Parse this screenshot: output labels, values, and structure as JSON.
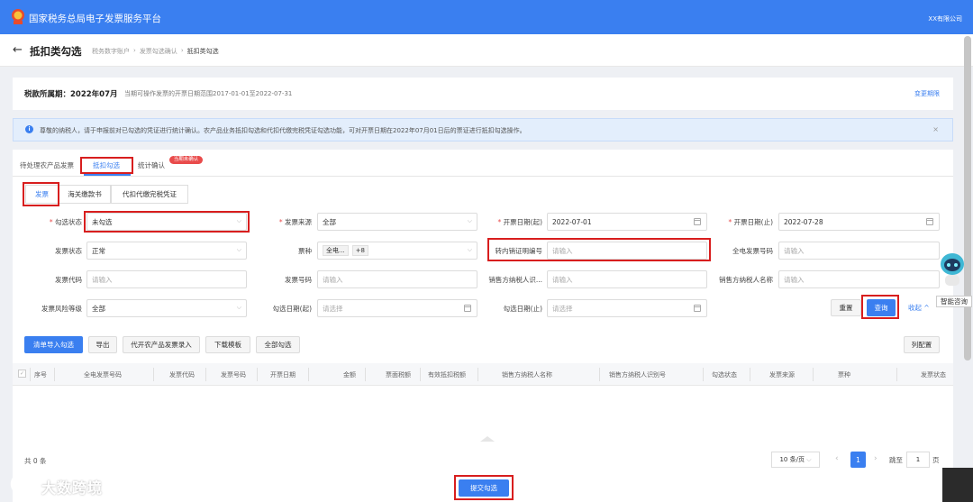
{
  "header": {
    "app_title": "国家税务总局电子发票服务平台",
    "company": "XX有限公司"
  },
  "page": {
    "title": "抵扣类勾选",
    "breadcrumb": [
      "税务数字账户",
      "发票勾选确认",
      "抵扣类勾选"
    ]
  },
  "period": {
    "label": "税款所属期：2022年07月",
    "desc": "当期可操作发票的开票日期范围2017-01-01至2022-07-31",
    "change": "变更期限"
  },
  "notice": {
    "text": "尊敬的纳税人，请于申报前对已勾选的凭证进行统计确认。农产品业务抵扣勾选和代扣代缴完税凭证勾选功能，可对开票日期在2022年07月01日后的票证进行抵扣勾选操作。"
  },
  "tabs1": [
    "待处理农产品发票",
    "抵扣勾选",
    "统计确认"
  ],
  "tabs1_badge": "当期未确认",
  "tabs2": [
    "发票",
    "海关缴款书",
    "代扣代缴完税凭证"
  ],
  "form": {
    "check_status": {
      "label": "勾选状态",
      "value": "未勾选"
    },
    "invoice_source": {
      "label": "发票来源",
      "value": "全部"
    },
    "date_start": {
      "label": "开票日期(起)",
      "value": "2022-07-01"
    },
    "date_end": {
      "label": "开票日期(止)",
      "value": "2022-07-28"
    },
    "invoice_status": {
      "label": "发票状态",
      "value": "正常"
    },
    "ticket_type": {
      "label": "票种",
      "tag1": "全电...",
      "tag2": "+8"
    },
    "transfer_no": {
      "label": "转内销证明编号",
      "placeholder": "请输入"
    },
    "full_invoice_no": {
      "label": "全电发票号码",
      "placeholder": "请输入"
    },
    "invoice_code": {
      "label": "发票代码",
      "placeholder": "请输入"
    },
    "invoice_number": {
      "label": "发票号码",
      "placeholder": "请输入"
    },
    "seller_tax_id": {
      "label": "销售方纳税人识...",
      "placeholder": "请输入"
    },
    "seller_name": {
      "label": "销售方纳税人名称",
      "placeholder": "请输入"
    },
    "risk_level": {
      "label": "发票风险等级",
      "value": "全部"
    },
    "check_date_start": {
      "label": "勾选日期(起)",
      "placeholder": "请选择"
    },
    "check_date_end": {
      "label": "勾选日期(止)",
      "placeholder": "请选择"
    },
    "reset": "重置",
    "query": "查询",
    "collapse": "收起"
  },
  "actions": [
    "清单导入勾选",
    "导出",
    "代开农产品发票录入",
    "下载模板",
    "全部勾选"
  ],
  "column_config": "列配置",
  "table": {
    "columns": [
      "序号",
      "全电发票号码",
      "发票代码",
      "发票号码",
      "开票日期",
      "金额",
      "票面税额",
      "有效抵扣税额",
      "销售方纳税人名称",
      "销售方纳税人识别号",
      "勾选状态",
      "发票来源",
      "票种",
      "发票状态"
    ],
    "rows": []
  },
  "pagination": {
    "total": "共 0 条",
    "page_size": "10 条/页",
    "current": "1",
    "goto_label": "跳至",
    "goto_value": "1",
    "page_unit": "页"
  },
  "submit": "提交勾选",
  "assistant": {
    "label": "智能咨询"
  },
  "watermark": {
    "text": "大数跨境"
  },
  "colors": {
    "primary": "#3a7ff0",
    "highlight": "#d81e1e"
  }
}
